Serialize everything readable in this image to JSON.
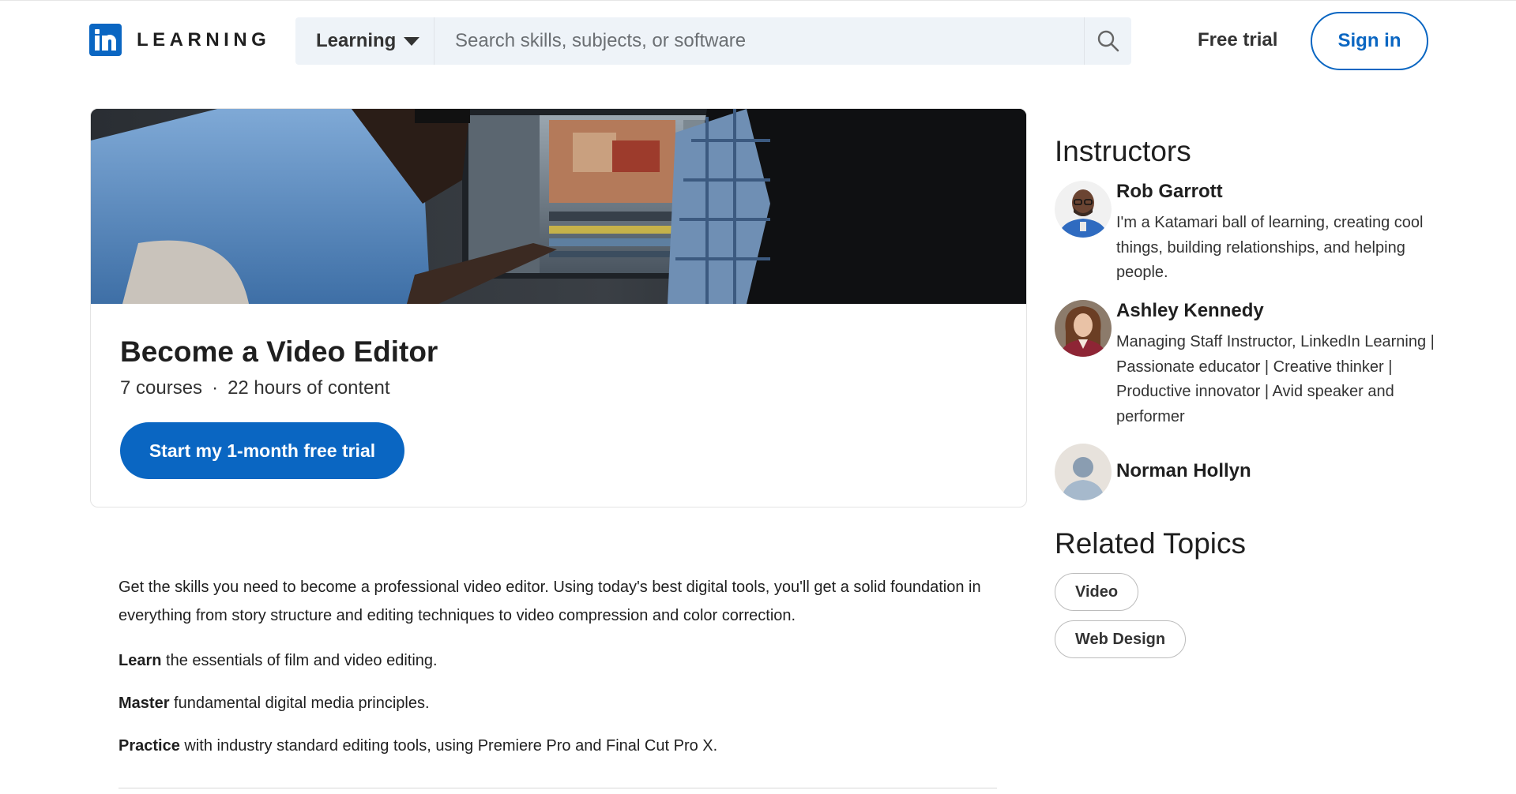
{
  "header": {
    "logo_text": "LEARNING",
    "category_label": "Learning",
    "search_placeholder": "Search skills, subjects, or software",
    "free_trial_label": "Free trial",
    "sign_in_label": "Sign in"
  },
  "hero": {
    "title": "Become a Video Editor",
    "course_count": "7 courses",
    "separator": "·",
    "content_hours": "22 hours of content",
    "cta_label": "Start my 1-month free trial"
  },
  "description": {
    "intro": "Get the skills you need to become a professional video editor. Using today's best digital tools, you'll get a solid foundation in everything from story structure and editing techniques to video compression and color correction.",
    "bullets": [
      {
        "lead": "Learn",
        "text": " the essentials of film and video editing."
      },
      {
        "lead": "Master",
        "text": " fundamental digital media principles."
      },
      {
        "lead": "Practice",
        "text": " with industry standard editing tools, using Premiere Pro and Final Cut Pro X."
      }
    ]
  },
  "sidebar": {
    "instructors_heading": "Instructors",
    "instructors": [
      {
        "name": "Rob Garrott",
        "bio": "I'm a Katamari ball of learning, creating cool things, building relationships, and helping people."
      },
      {
        "name": "Ashley Kennedy",
        "bio": "Managing Staff Instructor, LinkedIn Learning | Passionate educator | Creative thinker | Productive innovator | Avid speaker and performer"
      },
      {
        "name": "Norman Hollyn",
        "bio": ""
      }
    ],
    "related_heading": "Related Topics",
    "topics": [
      "Video",
      "Web Design"
    ]
  },
  "colors": {
    "brand_blue": "#0a66c2",
    "search_bg": "#eef3f8",
    "text_dark": "#1f1f1f"
  },
  "icons": {
    "search": "search-icon",
    "caret": "chevron-down-icon",
    "logo": "linkedin-logo-icon"
  }
}
